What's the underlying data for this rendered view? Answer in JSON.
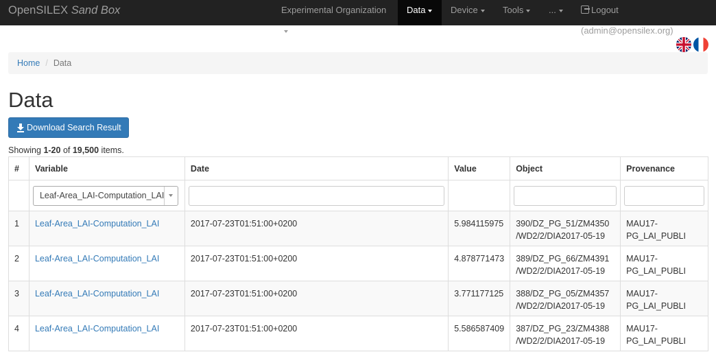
{
  "navbar": {
    "brand_main": "OpenSILEX",
    "brand_sub": "Sand Box",
    "items": [
      {
        "label": "Experimental Organization"
      },
      {
        "label": "Data"
      },
      {
        "label": "Device"
      },
      {
        "label": "Tools"
      },
      {
        "label": "..."
      }
    ],
    "logout": "Logout (admin@opensilex.org)"
  },
  "breadcrumb": {
    "home": "Home",
    "current": "Data"
  },
  "page_title": "Data",
  "download_button": "Download Search Result",
  "summary": {
    "prefix": "Showing ",
    "range": "1-20",
    "of": " of ",
    "total": "19,500",
    "suffix": " items."
  },
  "table": {
    "headers": [
      "#",
      "Variable",
      "Date",
      "Value",
      "Object",
      "Provenance"
    ],
    "variable_filter": "Leaf-Area_LAI-Computation_LAI",
    "rows": [
      {
        "num": "1",
        "variable": "Leaf-Area_LAI-Computation_LAI",
        "date": "2017-07-23T01:51:00+0200",
        "value": "5.984115975",
        "object_1": "390/DZ_PG_51/ZM4350",
        "object_2": "/WD2/2/DIA2017-05-19",
        "prov_1": "MAU17-",
        "prov_2": "PG_LAI_PUBLI"
      },
      {
        "num": "2",
        "variable": "Leaf-Area_LAI-Computation_LAI",
        "date": "2017-07-23T01:51:00+0200",
        "value": "4.878771473",
        "object_1": "389/DZ_PG_66/ZM4391",
        "object_2": "/WD2/2/DIA2017-05-19",
        "prov_1": "MAU17-",
        "prov_2": "PG_LAI_PUBLI"
      },
      {
        "num": "3",
        "variable": "Leaf-Area_LAI-Computation_LAI",
        "date": "2017-07-23T01:51:00+0200",
        "value": "3.771177125",
        "object_1": "388/DZ_PG_05/ZM4357",
        "object_2": "/WD2/2/DIA2017-05-19",
        "prov_1": "MAU17-",
        "prov_2": "PG_LAI_PUBLI"
      },
      {
        "num": "4",
        "variable": "Leaf-Area_LAI-Computation_LAI",
        "date": "2017-07-23T01:51:00+0200",
        "value": "5.586587409",
        "object_1": "387/DZ_PG_23/ZM4388",
        "object_2": "/WD2/2/DIA2017-05-19",
        "prov_1": "MAU17-",
        "prov_2": "PG_LAI_PUBLI"
      }
    ]
  },
  "icons": {
    "logout": "logout-icon",
    "download": "download-icon",
    "flag_en": "uk-flag-icon",
    "flag_fr": "france-flag-icon"
  },
  "colors": {
    "navbar_bg": "#222222",
    "active_nav_bg": "#080808",
    "link": "#337ab7",
    "button": "#337ab7"
  }
}
